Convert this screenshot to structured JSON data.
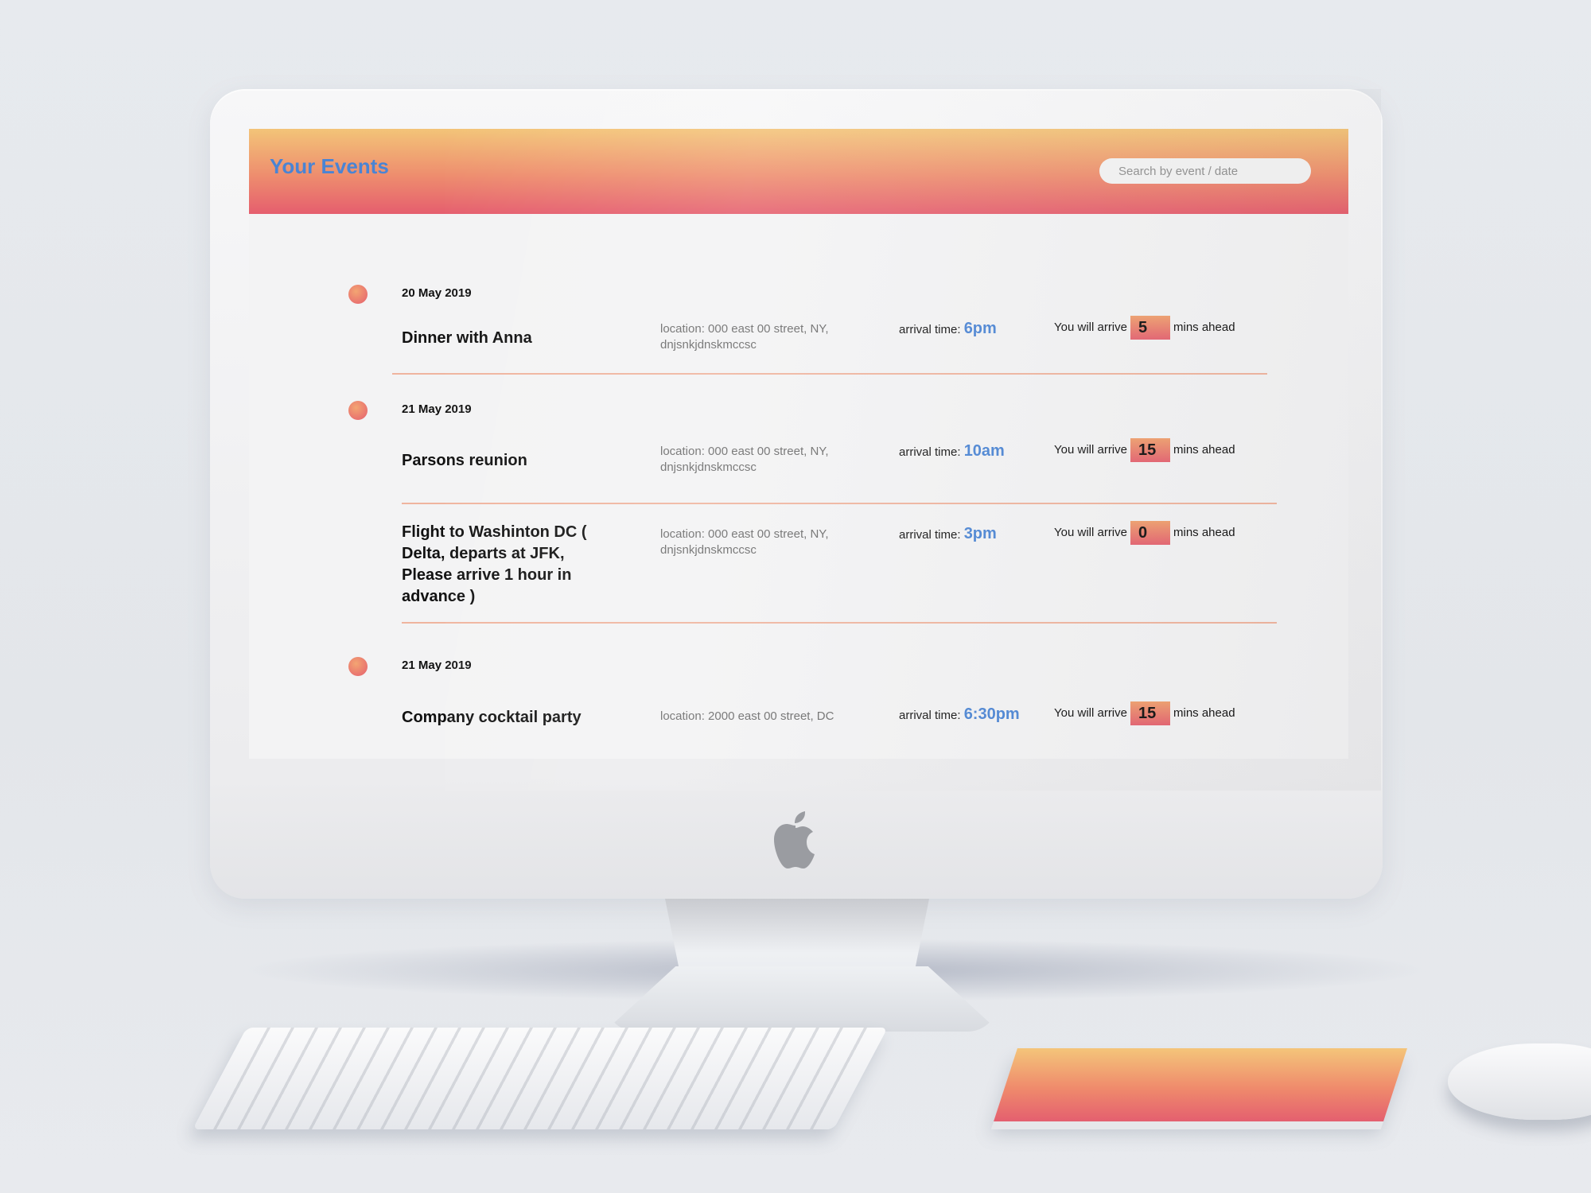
{
  "app": {
    "title": "Your Events",
    "search_placeholder": "Search by event / date"
  },
  "labels": {
    "location_prefix": "location:",
    "arrival_prefix": "arrival time:",
    "arrive_prefix": "You will arrive",
    "arrive_suffix": "mins ahead"
  },
  "events": [
    {
      "date": "20 May 2019",
      "title": "Dinner with Anna",
      "location": "location: 000 east 00 street, NY, dnjsnkjdnskmccsc",
      "arrival_label": "arrival time:",
      "arrival_time": "6pm",
      "arrive_label": "You will arrive",
      "mins_ahead": "5",
      "suffix": "mins ahead"
    },
    {
      "date": "21 May 2019",
      "title": "Parsons reunion",
      "location": "location: 000 east 00 street, NY, dnjsnkjdnskmccsc",
      "arrival_label": "arrival time:",
      "arrival_time": "10am",
      "arrive_label": "You will arrive",
      "mins_ahead": "15",
      "suffix": "mins ahead"
    },
    {
      "date": "",
      "title": "Flight to Washinton DC ( Delta, departs at JFK, Please arrive 1 hour in advance )",
      "location": "location: 000 east 00 street, NY, dnjsnkjdnskmccsc",
      "arrival_label": "arrival time:",
      "arrival_time": "3pm",
      "arrive_label": "You will arrive",
      "mins_ahead": "0",
      "suffix": "mins ahead"
    },
    {
      "date": "21 May 2019",
      "title": "Company cocktail party",
      "location": "location: 2000 east 00 street, DC",
      "arrival_label": "arrival time:",
      "arrival_time": "6:30pm",
      "arrive_label": "You will arrive",
      "mins_ahead": "15",
      "suffix": "mins ahead"
    }
  ],
  "colors": {
    "accent": "#4a84d4",
    "header_top": "#f3c478",
    "header_bottom": "#e55e6e",
    "divider": "#efb49e"
  }
}
